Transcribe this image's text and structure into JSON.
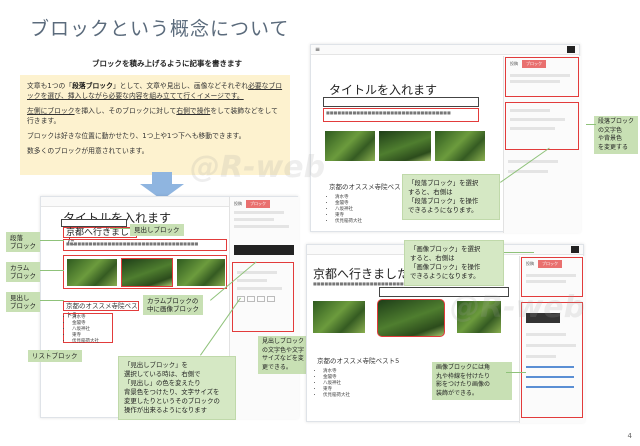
{
  "page": {
    "title": "ブロックという概念について",
    "subtitle": "ブロックを積み上げるように記事を書きます",
    "page_number": "4",
    "watermark": "@R-web"
  },
  "intro": {
    "p1_a": "文章も1つの「",
    "p1_b": "段落ブロック",
    "p1_c": "」として、文章や見出し、画像などそれぞれ",
    "p1_d": "必要なブロックを選び、挿入しながら必要な内容を組み立てて行くイメージです。",
    "p2_a": "左側にブロック",
    "p2_b": "を挿入し、そのブロックに対して",
    "p2_c": "右側で操作",
    "p2_d": "をして装飾などをして行きます。",
    "p3": "ブロックは好きな位置に動かせたり、1つ上や1つ下へも移動できます。",
    "p4": "数多くのブロックが用意されています。"
  },
  "left_editor": {
    "title": "タイトルを入れます",
    "heading": "京都へ行きました",
    "heading2": "京都のオススメ寺院ベスト5",
    "list": [
      "清水寺",
      "金閣寺",
      "八坂神社",
      "東寺",
      "伏見稲荷大社"
    ],
    "tab_active": "ブロック",
    "tab_inactive": "投稿"
  },
  "left_labels": {
    "heading_block": "見出しブロック",
    "paragraph_block": "段落\nブロック",
    "column_block": "カラム\nブロック",
    "heading_block2": "見出し\nブロック",
    "image_in_column": "カラムブロックの\n中に画像ブロック",
    "list_block": "リストブロック",
    "heading_callout": "「見出しブロック」を\n選択している時は、右側で\n「見出し」の色を変えたり\n背景色をつけたり、文字サイズを\n変更したりというそのブロックの\n操作が出来るようになります",
    "heading_side_note": "見出しブロック\nの文字色や文字\nサイズなどを変\n更できる。"
  },
  "right_top": {
    "title": "タイトルを入れます",
    "heading2": "京都のオススメ寺院ベスト5",
    "list": [
      "清水寺",
      "金閣寺",
      "八坂神社",
      "東寺",
      "伏見稲荷大社"
    ],
    "tab_active": "ブロック",
    "tab_inactive": "投稿",
    "side_note": "段落ブロック\nの文字色\nや背景色\nを変更する",
    "callout": "「段落ブロック」を選択\nすると、右側は\n「段落ブロック」を操作\nできるようになります。"
  },
  "right_bottom": {
    "title": "京都へ行きました",
    "heading2": "京都のオススメ寺院ベスト5",
    "list": [
      "清水寺",
      "金閣寺",
      "八坂神社",
      "東寺",
      "伏見稲荷大社"
    ],
    "tab_active": "ブロック",
    "tab_inactive": "投稿",
    "callout": "「画像ブロック」を選択\nすると、右側は\n「画像ブロック」を操作\nできるようになります。",
    "side_note": "画像ブロックには角\n丸や枠線を付けたり\n影をつけたり画像の\n装飾ができる。"
  }
}
